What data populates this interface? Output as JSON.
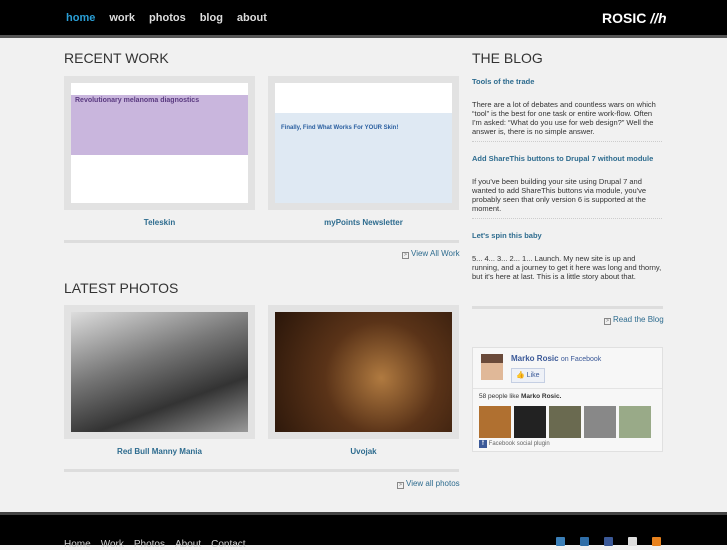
{
  "nav": {
    "items": [
      "home",
      "work",
      "photos",
      "blog",
      "about"
    ],
    "logo": "ROSIC"
  },
  "recent_work": {
    "title": "RECENT WORK",
    "items": [
      {
        "caption": "Teleskin",
        "thumb_text": "Revolutionary melanoma diagnostics"
      },
      {
        "caption": "myPoints Newsletter",
        "thumb_text": "Finally, Find What Works For YOUR Skin!"
      }
    ],
    "more": "View All Work"
  },
  "latest_photos": {
    "title": "LATEST PHOTOS",
    "items": [
      {
        "caption": "Red Bull Manny Mania"
      },
      {
        "caption": "Uvojak"
      }
    ],
    "more": "View all photos"
  },
  "blog": {
    "title": "THE BLOG",
    "posts": [
      {
        "title": "Tools of the trade",
        "excerpt": "There are a lot of debates and countless wars on which “tool” is the best for one task or entire work-flow. Often I'm asked: “What do you use for web design?” Well the answer is, there is no simple answer."
      },
      {
        "title": "Add ShareThis buttons to Drupal 7 without module",
        "excerpt": "If you've been building your site using Drupal 7 and wanted to add ShareThis buttons via module, you've probably seen that only version 6 is supported at the moment."
      },
      {
        "title": "Let's spin this baby",
        "excerpt": "5... 4... 3... 2... 1... Launch. My new site is up and running, and a journey to get it here was long and thorny, but it's here at last. This is a little story about that."
      }
    ],
    "more": "Read the Blog"
  },
  "facebook": {
    "name": "Marko Rosic",
    "on": "on Facebook",
    "like": "Like",
    "count_text": "58 people like",
    "count_name": "Marko Rosic.",
    "plugin": "Facebook social plugin"
  },
  "footer": {
    "items": [
      "Home",
      "Work",
      "Photos",
      "About",
      "Contact"
    ],
    "social": [
      "twitter",
      "linkedin",
      "facebook",
      "flickr",
      "rss"
    ]
  }
}
